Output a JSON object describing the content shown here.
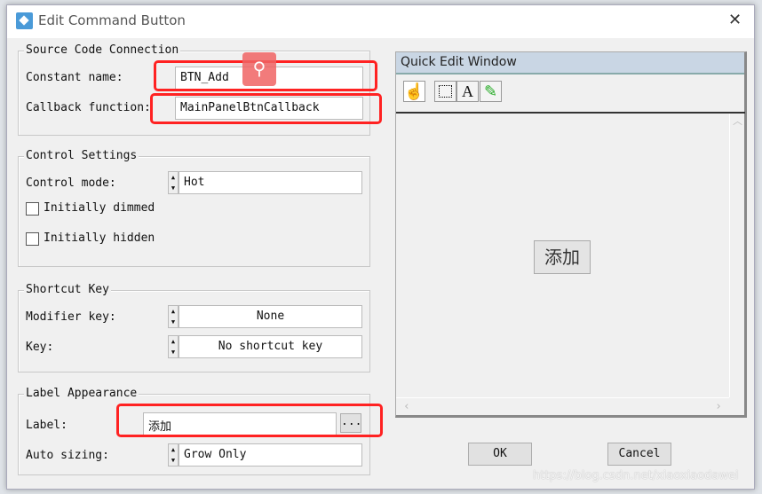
{
  "window": {
    "title": "Edit Command Button",
    "close": "✕"
  },
  "source": {
    "legend": "Source Code Connection",
    "constant_label": "Constant name:",
    "constant_value": "BTN_Add",
    "callback_label": "Callback function:",
    "callback_value": "MainPanelBtnCallback"
  },
  "control": {
    "legend": "Control Settings",
    "mode_label": "Control mode:",
    "mode_value": "Hot",
    "dimmed_label": "Initially dimmed",
    "dimmed_checked": false,
    "hidden_label": "Initially hidden",
    "hidden_checked": false
  },
  "shortcut": {
    "legend": "Shortcut Key",
    "modifier_label": "Modifier key:",
    "modifier_value": "None",
    "key_label": "Key:",
    "key_value": "No shortcut key"
  },
  "label_appearance": {
    "legend": "Label Appearance",
    "label_label": "Label:",
    "label_value": "添加",
    "browse": "...",
    "autosize_label": "Auto sizing:",
    "autosize_value": "Grow Only"
  },
  "quick_edit": {
    "title": "Quick Edit Window",
    "tools": [
      "operate-icon",
      "select-icon",
      "text-icon",
      "color-icon"
    ],
    "text_tool": "A",
    "preview_button": "添加"
  },
  "buttons": {
    "ok": "OK",
    "cancel": "Cancel"
  },
  "watermark": "https://blog.csdn.net/xiaoxiaodawei",
  "colors": {
    "highlight": "#ff2222",
    "qe_title": "#c9d6e4"
  }
}
